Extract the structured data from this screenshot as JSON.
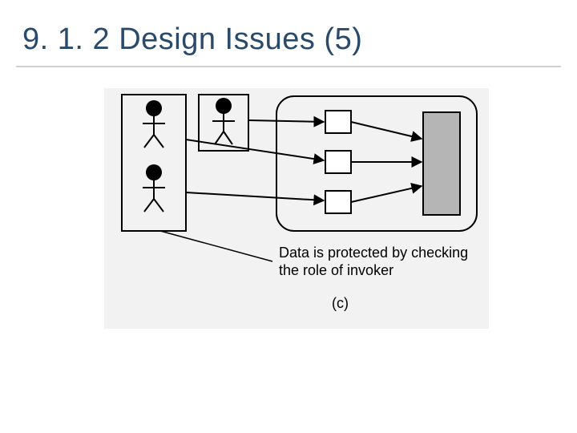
{
  "slide": {
    "heading": "9. 1. 2 Design Issues (5)",
    "caption": "Data is protected by checking the role of invoker",
    "subfig_label": "(c)",
    "icons": {
      "actor": "stick-figure",
      "mediator_box": "small-rect",
      "protected_object": "shaded-rect"
    }
  }
}
